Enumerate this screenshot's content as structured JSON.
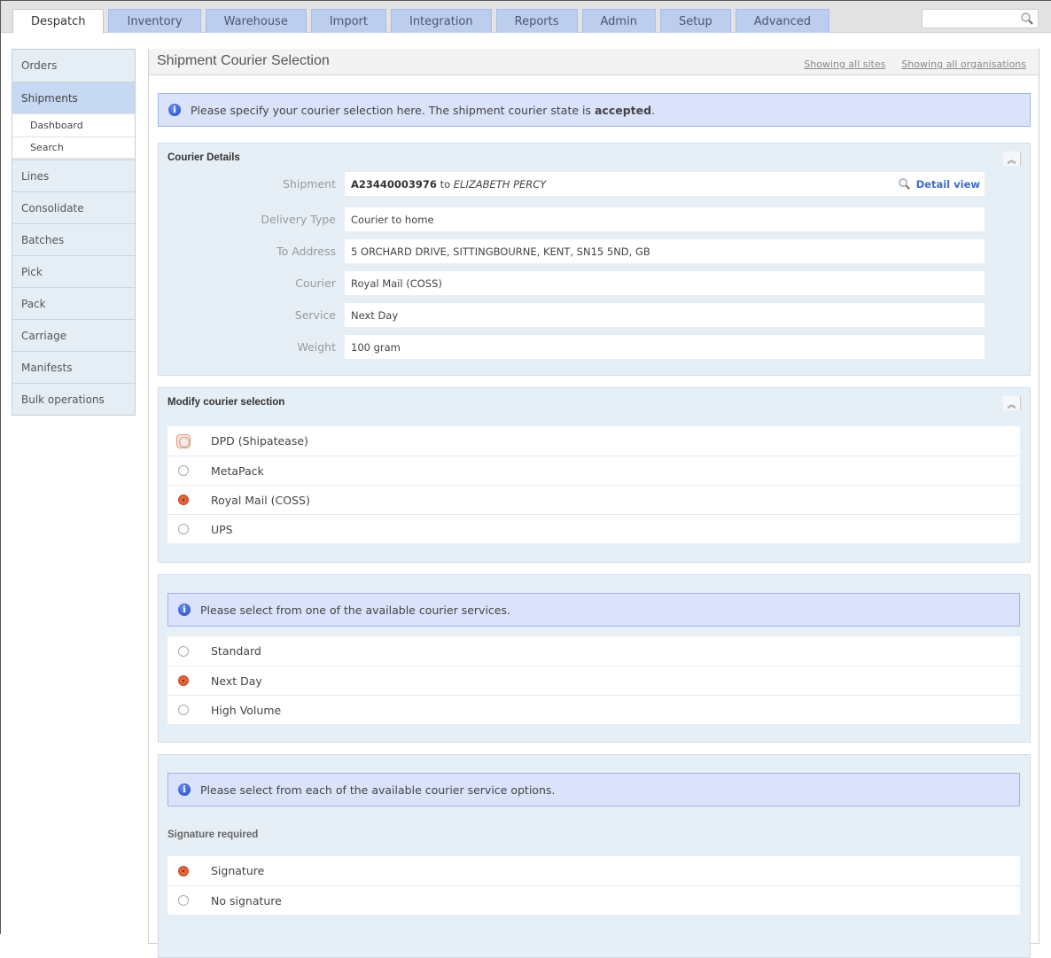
{
  "nav": {
    "tabs": [
      {
        "label": "Despatch",
        "active": true
      },
      {
        "label": "Inventory"
      },
      {
        "label": "Warehouse"
      },
      {
        "label": "Import"
      },
      {
        "label": "Integration"
      },
      {
        "label": "Reports"
      },
      {
        "label": "Admin"
      },
      {
        "label": "Setup"
      },
      {
        "label": "Advanced"
      }
    ],
    "search": {
      "value": "",
      "placeholder": "",
      "icon": "search-icon"
    }
  },
  "sidebar": {
    "items": [
      {
        "label": "Orders"
      },
      {
        "label": "Shipments",
        "active": true,
        "children": [
          {
            "label": "Dashboard"
          },
          {
            "label": "Search"
          }
        ]
      },
      {
        "label": "Lines"
      },
      {
        "label": "Consolidate"
      },
      {
        "label": "Batches"
      },
      {
        "label": "Pick"
      },
      {
        "label": "Pack"
      },
      {
        "label": "Carriage"
      },
      {
        "label": "Manifests"
      },
      {
        "label": "Bulk operations"
      }
    ]
  },
  "header": {
    "title": "Shipment Courier Selection",
    "links": [
      "Showing all sites",
      "Showing all organisations"
    ]
  },
  "info": {
    "text_prefix": "Please specify your courier selection here. The shipment courier state is ",
    "state": "accepted",
    "text_suffix": "."
  },
  "courier_details": {
    "title": "Courier Details",
    "collapse_icon": "double-chevron-up-icon",
    "shipment": {
      "label": "Shipment",
      "id": "A23440003976",
      "to": "to",
      "recipient": "ELIZABETH PERCY",
      "detail_link": "Detail view"
    },
    "fields": [
      {
        "label": "Delivery Type",
        "value": "Courier to home"
      },
      {
        "label": "To Address",
        "value": "5 ORCHARD DRIVE, SITTINGBOURNE, KENT, SN15 5ND, GB"
      },
      {
        "label": "Courier",
        "value": "Royal Mail (COSS)"
      },
      {
        "label": "Service",
        "value": "Next Day"
      },
      {
        "label": "Weight",
        "value": "100 gram"
      }
    ]
  },
  "modify_courier": {
    "title": "Modify courier selection",
    "options": [
      {
        "label": "DPD (Shipatease)",
        "checked": false,
        "focused": true
      },
      {
        "label": "MetaPack",
        "checked": false
      },
      {
        "label": "Royal Mail (COSS)",
        "checked": true
      },
      {
        "label": "UPS",
        "checked": false
      }
    ]
  },
  "services": {
    "info": "Please select from one of the available courier services.",
    "options": [
      {
        "label": "Standard",
        "checked": false
      },
      {
        "label": "Next Day",
        "checked": true
      },
      {
        "label": "High Volume",
        "checked": false
      }
    ]
  },
  "service_options": {
    "info": "Please select from each of the available courier service options.",
    "group_title": "Signature required",
    "options": [
      {
        "label": "Signature",
        "checked": true
      },
      {
        "label": "No signature",
        "checked": false
      }
    ]
  },
  "colors": {
    "accent_radio": "#e0633b",
    "tab_bg": "#bccdee",
    "info_bg": "#dbe3fb",
    "panel_bg": "#e7eff6"
  }
}
